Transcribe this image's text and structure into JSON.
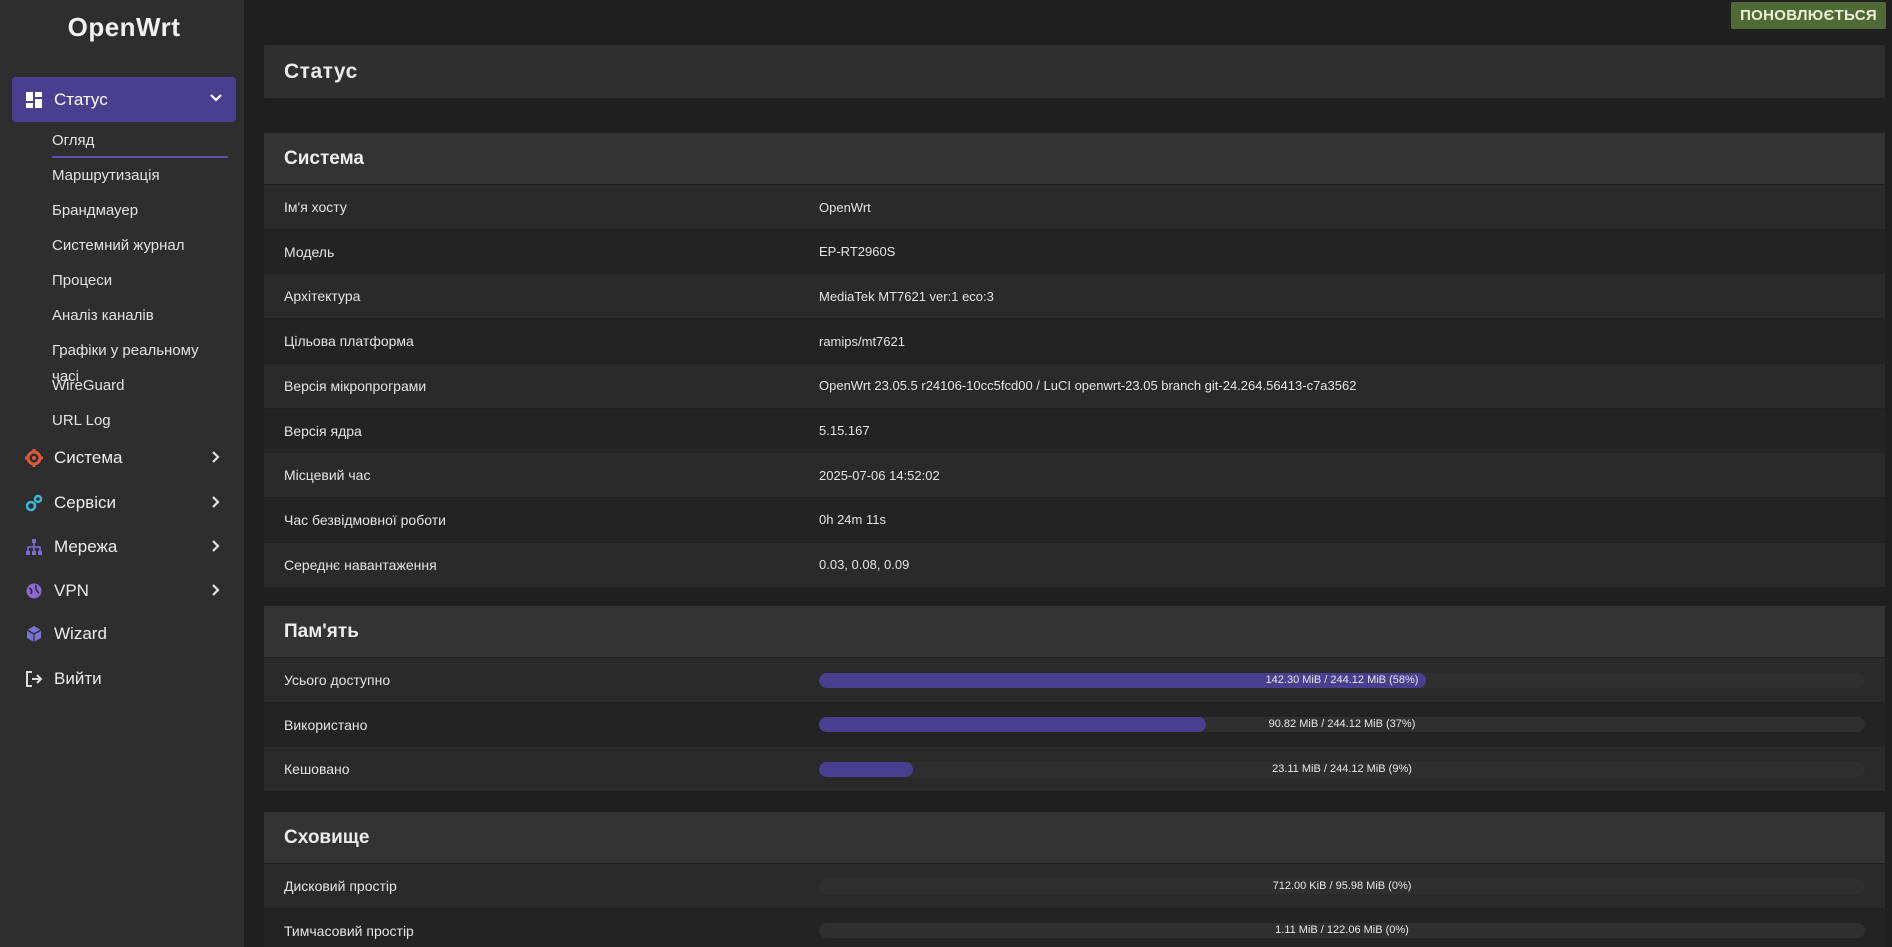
{
  "brand": "OpenWrt",
  "status_badge": "ПОНОВЛЮЄТЬСЯ",
  "page_title": "Статус",
  "sidebar": {
    "active": {
      "label": "Статус",
      "icon": "dashboard-icon"
    },
    "submenu": [
      {
        "label": "Огляд",
        "active": true
      },
      {
        "label": "Маршрутизація"
      },
      {
        "label": "Брандмауер"
      },
      {
        "label": "Системний журнал"
      },
      {
        "label": "Процеси"
      },
      {
        "label": "Аналіз каналів"
      },
      {
        "label": "Графіки у реальному часі"
      },
      {
        "label": "WireGuard"
      },
      {
        "label": "URL Log"
      }
    ],
    "items": [
      {
        "label": "Система",
        "icon": "gear-icon",
        "color": "#e0583a"
      },
      {
        "label": "Сервіси",
        "icon": "services-icon",
        "color": "#3ab7d6"
      },
      {
        "label": "Мережа",
        "icon": "network-icon",
        "color": "#7a6bd6"
      },
      {
        "label": "VPN",
        "icon": "globe-icon",
        "color": "#8a6bd6"
      },
      {
        "label": "Wizard",
        "icon": "cube-icon",
        "color": "#7a72d8"
      },
      {
        "label": "Вийти",
        "icon": "logout-icon",
        "color": "#dcdcdc"
      }
    ]
  },
  "system": {
    "title": "Система",
    "rows": [
      {
        "key": "Ім'я хосту",
        "value": "OpenWrt"
      },
      {
        "key": "Модель",
        "value": "EP-RT2960S"
      },
      {
        "key": "Архітектура",
        "value": "MediaTek MT7621 ver:1 eco:3"
      },
      {
        "key": "Цільова платформа",
        "value": "ramips/mt7621"
      },
      {
        "key": "Версія мікропрограми",
        "value": "OpenWrt 23.05.5 r24106-10cc5fcd00 / LuCI openwrt-23.05 branch git-24.264.56413-c7a3562"
      },
      {
        "key": "Версія ядра",
        "value": "5.15.167"
      },
      {
        "key": "Місцевий час",
        "value": "2025-07-06 14:52:02"
      },
      {
        "key": "Час безвідмовної роботи",
        "value": "0h 24m 11s"
      },
      {
        "key": "Середнє навантаження",
        "value": "0.03, 0.08, 0.09"
      }
    ]
  },
  "memory": {
    "title": "Пам'ять",
    "rows": [
      {
        "key": "Усього доступно",
        "text": "142.30 MiB / 244.12 MiB (58%)",
        "fraction": 0.58
      },
      {
        "key": "Використано",
        "text": "90.82 MiB / 244.12 MiB (37%)",
        "fraction": 0.37
      },
      {
        "key": "Кешовано",
        "text": "23.11 MiB / 244.12 MiB (9%)",
        "fraction": 0.09
      }
    ]
  },
  "storage": {
    "title": "Сховище",
    "rows": [
      {
        "key": "Дисковий простір",
        "text": "712.00 KiB / 95.98 MiB (0%)",
        "fraction": 0
      },
      {
        "key": "Тимчасовий простір",
        "text": "1.11 MiB / 122.06 MiB (0%)",
        "fraction": 0
      }
    ]
  }
}
